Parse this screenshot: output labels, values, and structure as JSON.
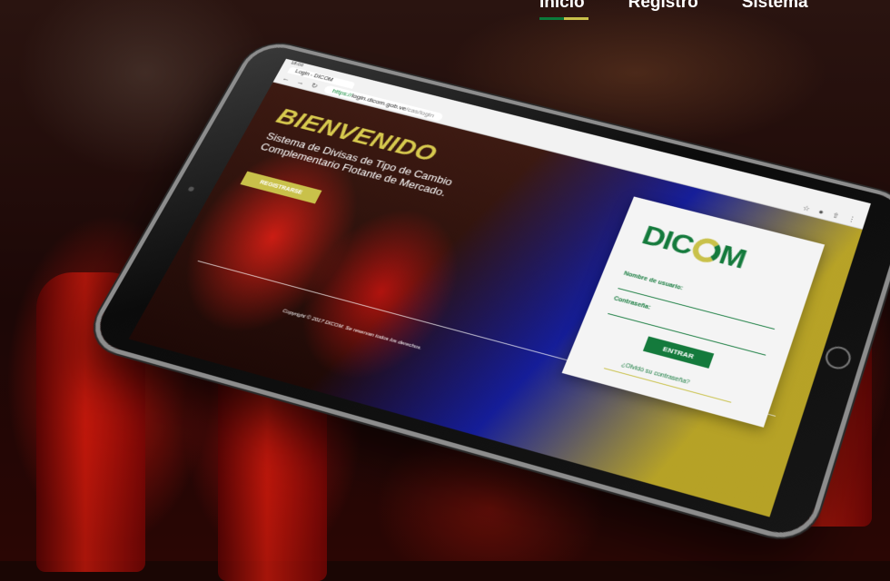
{
  "topnav": {
    "items": [
      {
        "label": "Inicio",
        "active": true
      },
      {
        "label": "Registro",
        "active": false
      },
      {
        "label": "Sistema",
        "active": false
      }
    ],
    "underline_colors": [
      "#0b7a3b",
      "#c9c14a"
    ]
  },
  "browser": {
    "status_time": "18:00",
    "tab_title": "Login - DICOM",
    "url_scheme": "https://",
    "url_host": "login.dicom.gob.ve",
    "url_path": "/cas/login"
  },
  "welcome": {
    "title": "BIENVENIDO",
    "subtitle": "Sistema de Divisas de Tipo de Cambio Complementario Flotante de Mercado.",
    "register_label": "REGISTRARSE"
  },
  "footer": {
    "copyright": "Copyright © 2017 DICOM. Se reservan todos los derechos."
  },
  "login": {
    "logo": "DICOM",
    "username_label": "Nombre de usuario:",
    "password_label": "Contraseña:",
    "submit_label": "ENTRAR",
    "forgot_label": "¿Olvidó su contraseña?"
  },
  "colors": {
    "brand_green": "#147a3c",
    "brand_gold": "#c9c14a"
  },
  "icons": [
    "back-icon",
    "forward-icon",
    "reload-icon",
    "star-icon",
    "mic-icon",
    "share-icon",
    "menu-icon"
  ]
}
